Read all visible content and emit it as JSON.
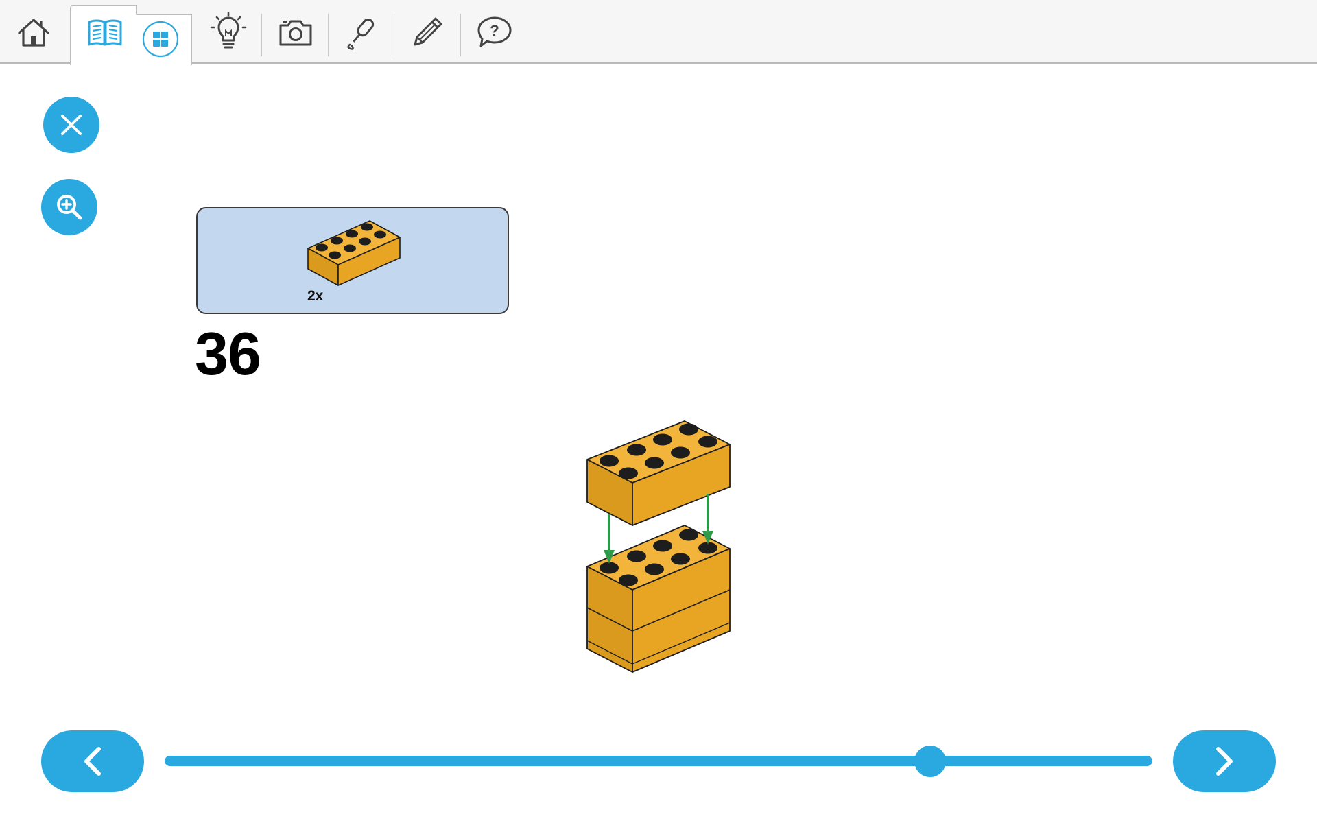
{
  "toolbar": {
    "items": [
      {
        "name": "home",
        "icon": "home-icon"
      },
      {
        "name": "building-instructions",
        "icon": "open-book-icon",
        "active": true
      },
      {
        "name": "overview",
        "icon": "grid-icon"
      },
      {
        "name": "ideas",
        "icon": "lightbulb-icon"
      },
      {
        "name": "camera",
        "icon": "camera-icon"
      },
      {
        "name": "record",
        "icon": "microphone-icon"
      },
      {
        "name": "edit",
        "icon": "pencil-icon"
      },
      {
        "name": "help",
        "icon": "help-bubble-icon"
      }
    ]
  },
  "side_controls": {
    "close_icon": "close-icon",
    "zoom_icon": "zoom-in-icon"
  },
  "step": {
    "number": "36",
    "parts": [
      {
        "label": "2x",
        "brick": "2x4 brick",
        "color": "#e8a524"
      }
    ]
  },
  "navigation": {
    "prev_icon": "chevron-left-icon",
    "next_icon": "chevron-right-icon",
    "progress": 0.775
  },
  "colors": {
    "accent": "#2aa8e0",
    "brick": "#e8a524",
    "parts_bg": "#c3d8ef",
    "arrow": "#2e9a4a"
  }
}
